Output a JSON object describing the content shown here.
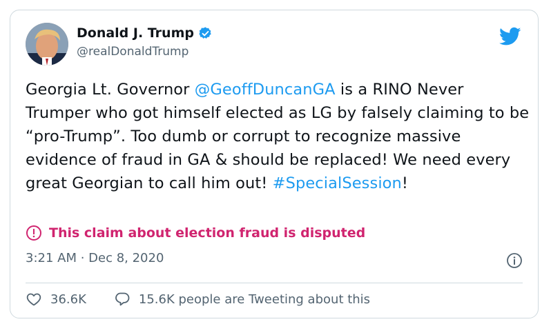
{
  "author": {
    "name": "Donald J. Trump",
    "handle": "@realDonaldTrump"
  },
  "tweet": {
    "text_part1": "Georgia Lt. Governor ",
    "mention": "@GeoffDuncanGA",
    "text_part2": " is a RINO Never Trumper who got himself elected as LG by falsely claiming to be “pro-Trump”. Too dumb or corrupt to recognize massive evidence of fraud in GA & should be replaced! We need every great Georgian to call him out! ",
    "hashtag": "#SpecialSession",
    "text_part3": "!"
  },
  "warning": {
    "text": "This claim about election fraud is disputed",
    "icon": "exclamation-circle-icon",
    "color": "#d0246f"
  },
  "timestamp": "3:21 AM · Dec 8, 2020",
  "actions": {
    "likes": "36.6K",
    "replies_text": "15.6K people are Tweeting about this"
  },
  "colors": {
    "accent": "#1d9bf0",
    "secondary_text": "#536471",
    "border": "#cfd9de"
  }
}
